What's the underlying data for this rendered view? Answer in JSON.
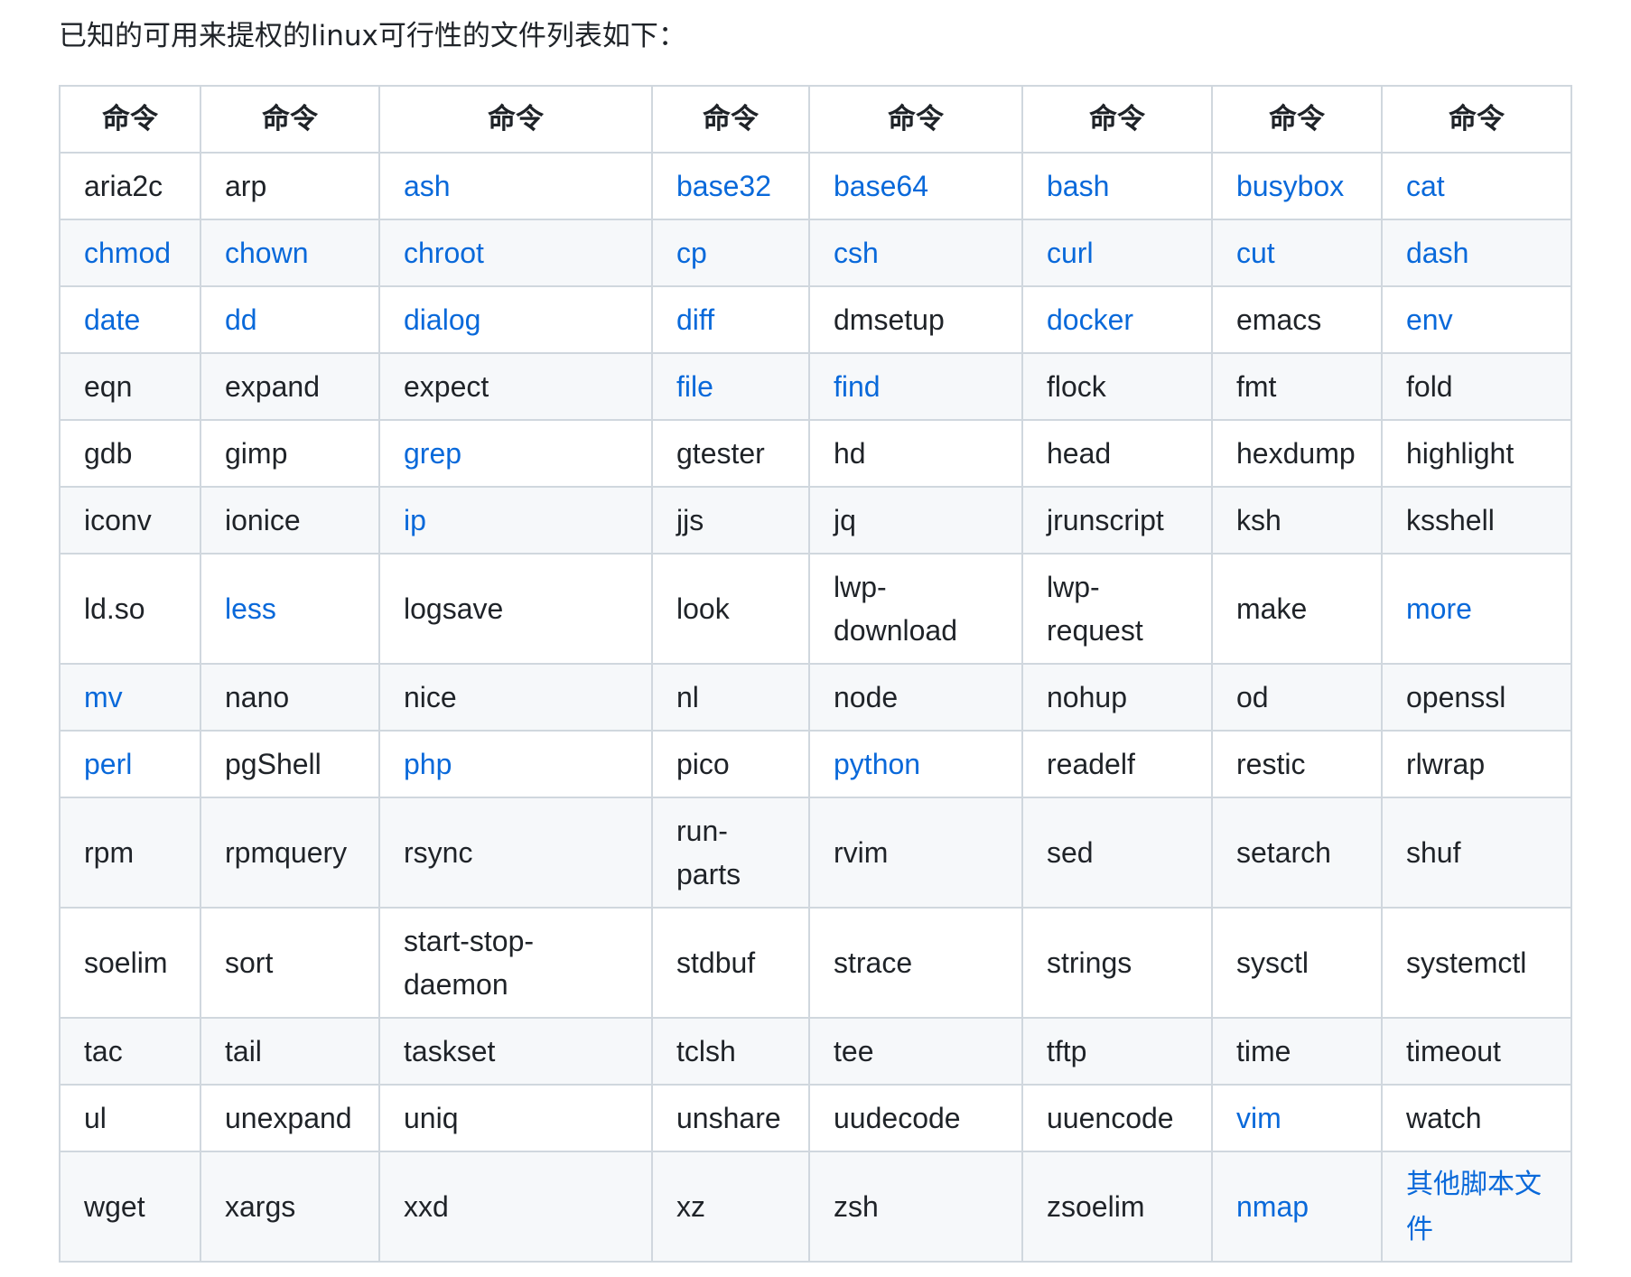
{
  "intro": "已知的可用来提权的linux可行性的文件列表如下：",
  "table": {
    "headers": [
      "命令",
      "命令",
      "命令",
      "命令",
      "命令",
      "命令",
      "命令",
      "命令"
    ],
    "rows": [
      [
        {
          "text": "aria2c",
          "link": false
        },
        {
          "text": "arp",
          "link": false
        },
        {
          "text": "ash",
          "link": true
        },
        {
          "text": "base32",
          "link": true
        },
        {
          "text": "base64",
          "link": true
        },
        {
          "text": "bash",
          "link": true
        },
        {
          "text": "busybox",
          "link": true
        },
        {
          "text": "cat",
          "link": true
        }
      ],
      [
        {
          "text": "chmod",
          "link": true
        },
        {
          "text": "chown",
          "link": true
        },
        {
          "text": "chroot",
          "link": true
        },
        {
          "text": "cp",
          "link": true
        },
        {
          "text": "csh",
          "link": true
        },
        {
          "text": "curl",
          "link": true
        },
        {
          "text": "cut",
          "link": true
        },
        {
          "text": "dash",
          "link": true
        }
      ],
      [
        {
          "text": "date",
          "link": true
        },
        {
          "text": "dd",
          "link": true
        },
        {
          "text": "dialog",
          "link": true
        },
        {
          "text": "diff",
          "link": true
        },
        {
          "text": "dmsetup",
          "link": false
        },
        {
          "text": "docker",
          "link": true
        },
        {
          "text": "emacs",
          "link": false
        },
        {
          "text": "env",
          "link": true
        }
      ],
      [
        {
          "text": "eqn",
          "link": false
        },
        {
          "text": "expand",
          "link": false
        },
        {
          "text": "expect",
          "link": false
        },
        {
          "text": "file",
          "link": true
        },
        {
          "text": "find",
          "link": true
        },
        {
          "text": "flock",
          "link": false
        },
        {
          "text": "fmt",
          "link": false
        },
        {
          "text": "fold",
          "link": false
        }
      ],
      [
        {
          "text": "gdb",
          "link": false
        },
        {
          "text": "gimp",
          "link": false
        },
        {
          "text": "grep",
          "link": true
        },
        {
          "text": "gtester",
          "link": false
        },
        {
          "text": "hd",
          "link": false
        },
        {
          "text": "head",
          "link": false
        },
        {
          "text": "hexdump",
          "link": false
        },
        {
          "text": "highlight",
          "link": false
        }
      ],
      [
        {
          "text": "iconv",
          "link": false
        },
        {
          "text": "ionice",
          "link": false
        },
        {
          "text": "ip",
          "link": true
        },
        {
          "text": "jjs",
          "link": false
        },
        {
          "text": "jq",
          "link": false
        },
        {
          "text": "jrunscript",
          "link": false
        },
        {
          "text": "ksh",
          "link": false
        },
        {
          "text": "ksshell",
          "link": false
        }
      ],
      [
        {
          "text": "ld.so",
          "link": false
        },
        {
          "text": "less",
          "link": true
        },
        {
          "text": "logsave",
          "link": false
        },
        {
          "text": "look",
          "link": false
        },
        {
          "text": "lwp-download",
          "link": false
        },
        {
          "text": "lwp-request",
          "link": false
        },
        {
          "text": "make",
          "link": false
        },
        {
          "text": "more",
          "link": true
        }
      ],
      [
        {
          "text": "mv",
          "link": true
        },
        {
          "text": "nano",
          "link": false
        },
        {
          "text": "nice",
          "link": false
        },
        {
          "text": "nl",
          "link": false
        },
        {
          "text": "node",
          "link": false
        },
        {
          "text": "nohup",
          "link": false
        },
        {
          "text": "od",
          "link": false
        },
        {
          "text": "openssl",
          "link": false
        }
      ],
      [
        {
          "text": "perl",
          "link": true
        },
        {
          "text": "pgShell",
          "link": false
        },
        {
          "text": "php",
          "link": true
        },
        {
          "text": "pico",
          "link": false
        },
        {
          "text": "python",
          "link": true
        },
        {
          "text": "readelf",
          "link": false
        },
        {
          "text": "restic",
          "link": false
        },
        {
          "text": "rlwrap",
          "link": false
        }
      ],
      [
        {
          "text": "rpm",
          "link": false
        },
        {
          "text": "rpmquery",
          "link": false
        },
        {
          "text": "rsync",
          "link": false
        },
        {
          "text": "run-parts",
          "link": false
        },
        {
          "text": "rvim",
          "link": false
        },
        {
          "text": "sed",
          "link": false
        },
        {
          "text": "setarch",
          "link": false
        },
        {
          "text": "shuf",
          "link": false
        }
      ],
      [
        {
          "text": "soelim",
          "link": false
        },
        {
          "text": "sort",
          "link": false
        },
        {
          "text": "start-stop-daemon",
          "link": false
        },
        {
          "text": "stdbuf",
          "link": false
        },
        {
          "text": "strace",
          "link": false
        },
        {
          "text": "strings",
          "link": false
        },
        {
          "text": "sysctl",
          "link": false
        },
        {
          "text": "systemctl",
          "link": false
        }
      ],
      [
        {
          "text": "tac",
          "link": false
        },
        {
          "text": "tail",
          "link": false
        },
        {
          "text": "taskset",
          "link": false
        },
        {
          "text": "tclsh",
          "link": false
        },
        {
          "text": "tee",
          "link": false
        },
        {
          "text": "tftp",
          "link": false
        },
        {
          "text": "time",
          "link": false
        },
        {
          "text": "timeout",
          "link": false
        }
      ],
      [
        {
          "text": "ul",
          "link": false
        },
        {
          "text": "unexpand",
          "link": false
        },
        {
          "text": "uniq",
          "link": false
        },
        {
          "text": "unshare",
          "link": false
        },
        {
          "text": "uudecode",
          "link": false
        },
        {
          "text": "uuencode",
          "link": false
        },
        {
          "text": "vim",
          "link": true
        },
        {
          "text": "watch",
          "link": false
        }
      ],
      [
        {
          "text": "wget",
          "link": false
        },
        {
          "text": "xargs",
          "link": false
        },
        {
          "text": "xxd",
          "link": false
        },
        {
          "text": "xz",
          "link": false
        },
        {
          "text": "zsh",
          "link": false
        },
        {
          "text": "zsoelim",
          "link": false
        },
        {
          "text": "nmap",
          "link": true
        },
        {
          "text": "其他脚本文件",
          "link": true
        }
      ]
    ]
  },
  "colors": {
    "link": "#0969da",
    "text": "#1f2328",
    "border": "#d0d7de",
    "stripe": "#f6f8fa"
  }
}
